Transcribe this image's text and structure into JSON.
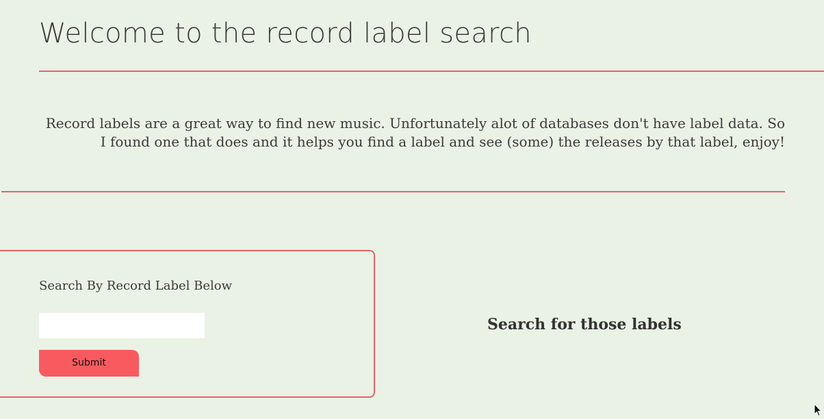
{
  "header": {
    "title": "Welcome to the record label search"
  },
  "intro": {
    "text": "Record labels are a great way to find new music. Unfortunately alot of databases don't have label data. So I found one that does and it helps you find a label and see (some) the releases by that label, enjoy!"
  },
  "search": {
    "label": "Search By Record Label Below",
    "input_value": "",
    "placeholder": "",
    "submit_label": "Submit"
  },
  "results": {
    "heading": "Search for those labels"
  },
  "colors": {
    "background": "#eaf1e5",
    "accent_line": "#e0656a",
    "button": "#f85a60",
    "text": "#333333"
  },
  "icons": {
    "cursor": "mouse-pointer-icon"
  }
}
